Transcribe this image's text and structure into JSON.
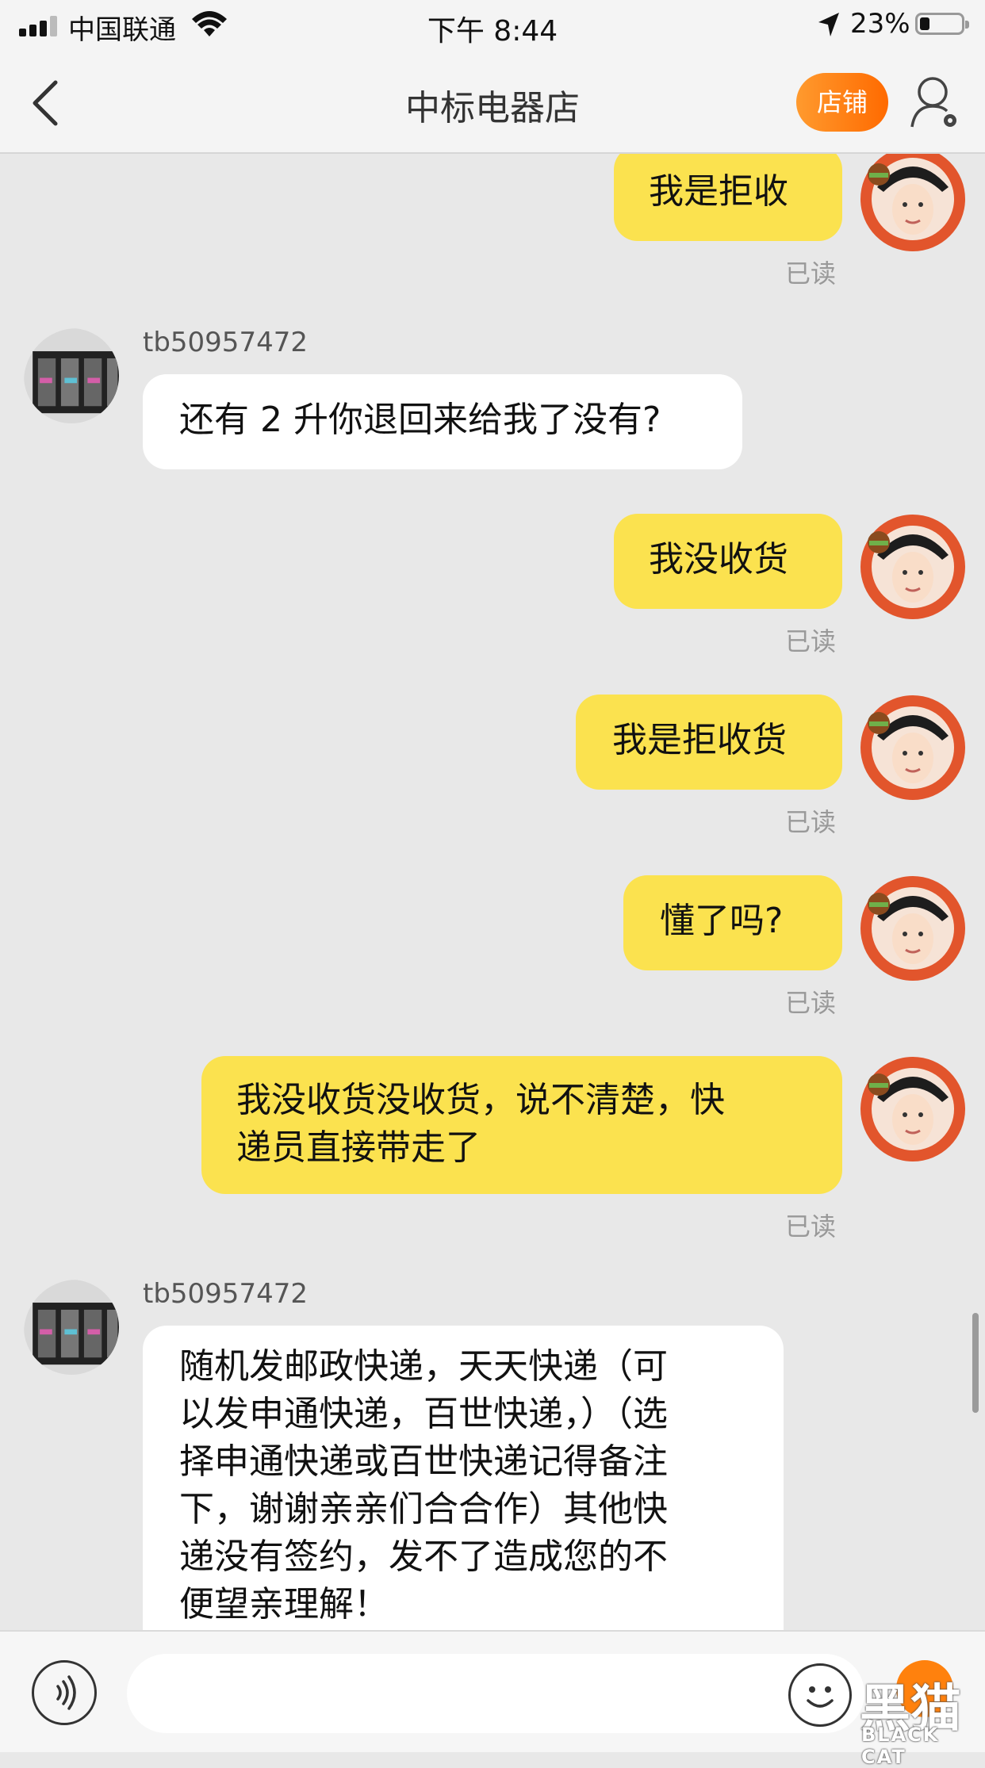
{
  "status_bar": {
    "carrier": "中国联通",
    "time": "下午 8:44",
    "battery_percent": "23%",
    "battery_level": 0.23,
    "icons": [
      "signal-icon",
      "wifi-icon",
      "location-arrow-icon",
      "battery-icon"
    ]
  },
  "nav": {
    "title": "中标电器店",
    "shop_button": "店铺",
    "icons": [
      "back-chevron-icon",
      "user-settings-icon"
    ]
  },
  "messages": [
    {
      "from": "me",
      "text": "我是拒收",
      "status": "已读"
    },
    {
      "from": "other",
      "sender": "tb50957472",
      "text": "还有 2 升你退回来给我了没有?"
    },
    {
      "from": "me",
      "text": "我没收货",
      "status": "已读"
    },
    {
      "from": "me",
      "text": "我是拒收货",
      "status": "已读"
    },
    {
      "from": "me",
      "text": "懂了吗?",
      "status": "已读"
    },
    {
      "from": "me",
      "text": "我没收货没收货，说不清楚，快\n递员直接带走了",
      "status": "已读"
    },
    {
      "from": "other",
      "sender": "tb50957472",
      "text": "随机发邮政快递，天天快递（可\n以发申通快递，百世快递，）（选\n择申通快递或百世快递记得备注\n下，谢谢亲亲们合合作）其他快\n递没有签约，发不了造成您的不\n便望亲理解！"
    }
  ],
  "input_bar": {
    "placeholder": "",
    "icons": [
      "voice-icon",
      "emoji-icon"
    ]
  },
  "watermark": {
    "text": "黑猫",
    "sub": "BLACK CAT"
  },
  "colors": {
    "my_bubble": "#fbe24f",
    "their_bubble": "#ffffff",
    "background": "#e8e8e8",
    "shop_button": "#ff7a10"
  }
}
